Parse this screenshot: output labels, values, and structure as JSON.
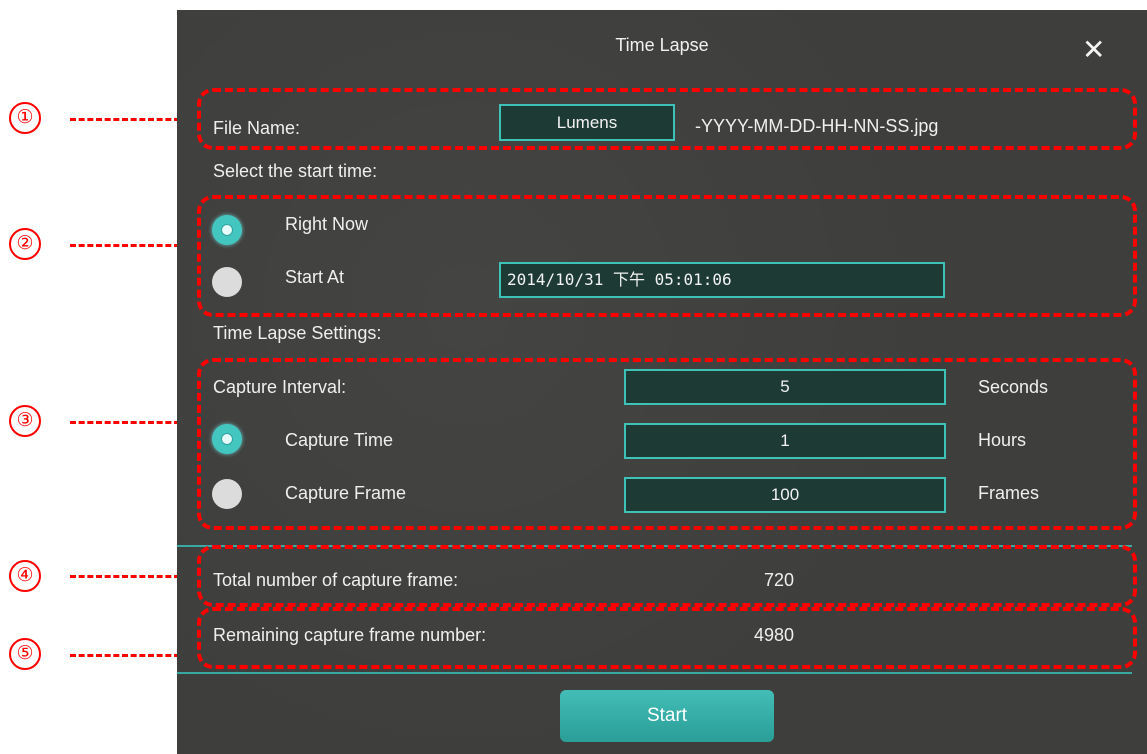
{
  "dialog": {
    "title": "Time Lapse",
    "close_symbol": "✕"
  },
  "file": {
    "label": "File Name:",
    "value": "Lumens",
    "suffix": "-YYYY-MM-DD-HH-NN-SS.jpg"
  },
  "start_time": {
    "heading": "Select the start time:",
    "right_now_label": "Right Now",
    "right_now_selected": true,
    "start_at_label": "Start At",
    "start_at_selected": false,
    "datetime_value": "2014/10/31 下午 05:01:06"
  },
  "settings": {
    "heading": "Time Lapse Settings:",
    "interval_label": "Capture Interval:",
    "interval_value": "5",
    "interval_unit": "Seconds",
    "capture_time_label": "Capture Time",
    "capture_time_selected": true,
    "capture_time_value": "1",
    "capture_time_unit": "Hours",
    "capture_frame_label": "Capture Frame",
    "capture_frame_selected": false,
    "capture_frame_value": "100",
    "capture_frame_unit": "Frames"
  },
  "totals": {
    "total_label": "Total number of capture frame:",
    "total_value": "720",
    "remaining_label": "Remaining capture frame number:",
    "remaining_value": "4980"
  },
  "actions": {
    "start_label": "Start"
  },
  "callouts": [
    "①",
    "②",
    "③",
    "④",
    "⑤"
  ],
  "colors": {
    "annotation": "#ff0000",
    "accent": "#3ec1b6",
    "dialog_bg": "#3e3e3c",
    "field_bg": "#1d3a34"
  }
}
